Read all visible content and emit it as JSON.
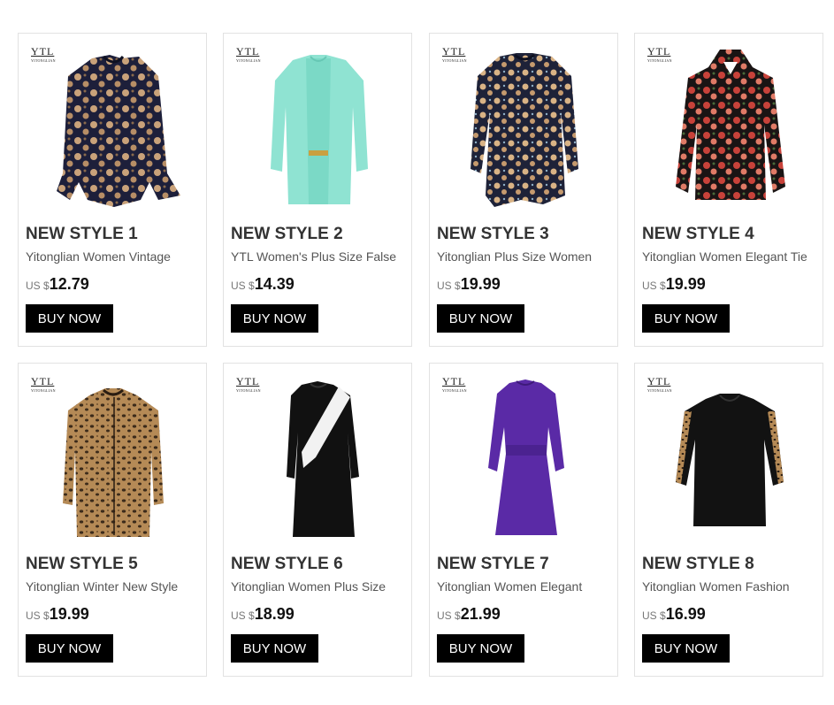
{
  "products": [
    {
      "title": "NEW STYLE 1",
      "desc": "Yitonglian Women Vintage",
      "currency": "US $",
      "price": "12.79",
      "button": "BUY NOW",
      "logo": "YTL",
      "logo_sub": "YITONGLIAN",
      "image": "floral-navy-blouse",
      "colors": {
        "main": "#1d1f3a",
        "accent": "#c9a27a"
      }
    },
    {
      "title": "NEW STYLE 2",
      "desc": "YTL Women's Plus Size False",
      "currency": "US $",
      "price": "14.39",
      "button": "BUY NOW",
      "logo": "YTL",
      "logo_sub": "YITONGLIAN",
      "image": "mint-lace-cardigan-top",
      "colors": {
        "main": "#8fe3d2",
        "accent": "#6fd1bf"
      }
    },
    {
      "title": "NEW STYLE 3",
      "desc": "Yitonglian Plus Size Women",
      "currency": "US $",
      "price": "19.99",
      "button": "BUY NOW",
      "logo": "YTL",
      "logo_sub": "YITONGLIAN",
      "image": "floral-peplum-blouse",
      "colors": {
        "main": "#1e2238",
        "accent": "#d9b385"
      }
    },
    {
      "title": "NEW STYLE 4",
      "desc": "Yitonglian Women Elegant Tie",
      "currency": "US $",
      "price": "19.99",
      "button": "BUY NOW",
      "logo": "YTL",
      "logo_sub": "YITONGLIAN",
      "image": "red-floral-blouse",
      "colors": {
        "main": "#1a1414",
        "accent": "#c8423a"
      }
    },
    {
      "title": "NEW STYLE 5",
      "desc": "Yitonglian Winter New Style",
      "currency": "US $",
      "price": "19.99",
      "button": "BUY NOW",
      "logo": "YTL",
      "logo_sub": "YITONGLIAN",
      "image": "leopard-coat",
      "colors": {
        "main": "#a37a4a",
        "accent": "#3b2a1a"
      }
    },
    {
      "title": "NEW STYLE 6",
      "desc": "Yitonglian Women Plus Size",
      "currency": "US $",
      "price": "18.99",
      "button": "BUY NOW",
      "logo": "YTL",
      "logo_sub": "YITONGLIAN",
      "image": "black-white-dress",
      "colors": {
        "main": "#111111",
        "accent": "#f2f2f2"
      }
    },
    {
      "title": "NEW STYLE 7",
      "desc": "Yitonglian Women Elegant",
      "currency": "US $",
      "price": "21.99",
      "button": "BUY NOW",
      "logo": "YTL",
      "logo_sub": "YITONGLIAN",
      "image": "purple-dress",
      "colors": {
        "main": "#5a2aa6",
        "accent": "#3e1a7a"
      }
    },
    {
      "title": "NEW STYLE 8",
      "desc": "Yitonglian Women Fashion",
      "currency": "US $",
      "price": "16.99",
      "button": "BUY NOW",
      "logo": "YTL",
      "logo_sub": "YITONGLIAN",
      "image": "black-leopard-sleeve-top",
      "colors": {
        "main": "#121212",
        "accent": "#a37a4a"
      }
    }
  ]
}
